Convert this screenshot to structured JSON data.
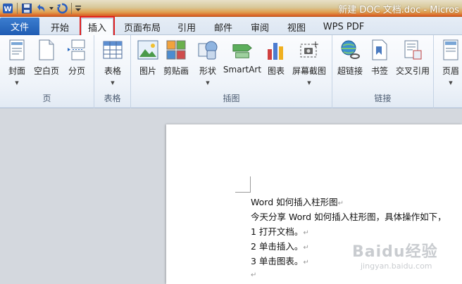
{
  "titlebar": {
    "title": "新建 DOC 文档.doc - Micros"
  },
  "tabs": {
    "file": "文件",
    "items": [
      "开始",
      "插入",
      "页面布局",
      "引用",
      "邮件",
      "审阅",
      "视图",
      "WPS PDF"
    ],
    "active": "插入"
  },
  "ribbon": {
    "groups": [
      {
        "label": "页",
        "buttons": [
          "封面",
          "空白页",
          "分页"
        ]
      },
      {
        "label": "表格",
        "buttons": [
          "表格"
        ]
      },
      {
        "label": "插图",
        "buttons": [
          "图片",
          "剪贴画",
          "形状",
          "SmartArt",
          "图表",
          "屏幕截图"
        ]
      },
      {
        "label": "链接",
        "buttons": [
          "超链接",
          "书签",
          "交叉引用"
        ]
      },
      {
        "label": "",
        "buttons": [
          "页眉"
        ]
      }
    ]
  },
  "document": {
    "lines": [
      "Word 如何插入柱形图",
      "今天分享 Word 如何插入柱形图，具体操作如下，",
      "1 打开文档。",
      "2 单击插入。",
      "3 单击图表。",
      ""
    ]
  },
  "watermark": {
    "main": "Baidu经验",
    "sub": "jingyan.baidu.com"
  }
}
